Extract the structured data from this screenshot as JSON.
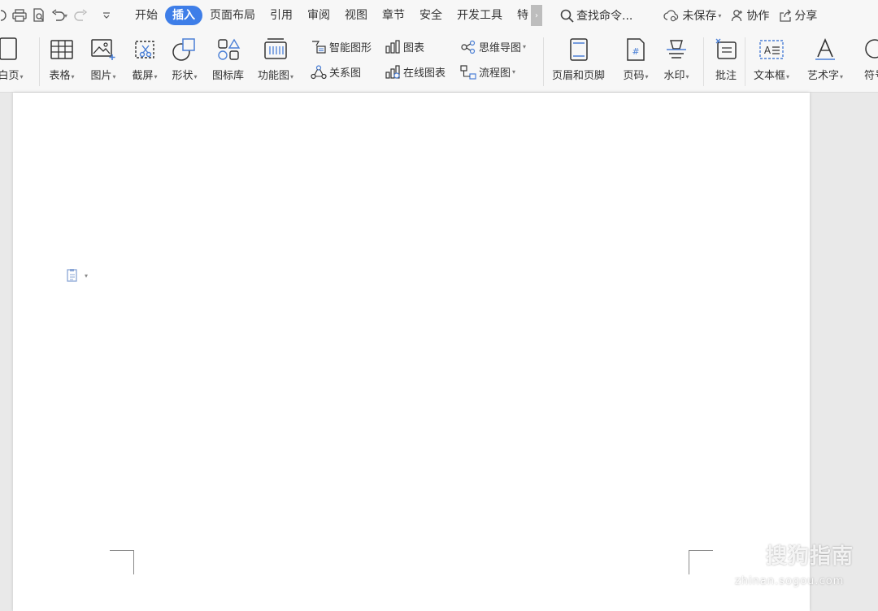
{
  "menu": {
    "tabs": [
      {
        "label": "开始"
      },
      {
        "label": "插入",
        "active": true
      },
      {
        "label": "页面布局"
      },
      {
        "label": "引用"
      },
      {
        "label": "审阅"
      },
      {
        "label": "视图"
      },
      {
        "label": "章节"
      },
      {
        "label": "安全"
      },
      {
        "label": "开发工具"
      },
      {
        "label": "特"
      }
    ],
    "more_glyph": "›",
    "search_label": "查找命令...",
    "unsaved_label": "未保存",
    "collab_label": "协作",
    "share_label": "分享"
  },
  "ribbon": {
    "blank_page": "白页",
    "table": "表格",
    "picture": "图片",
    "screenshot": "截屏",
    "shape": "形状",
    "icon_library": "图标库",
    "function_chart": "功能图",
    "smart_art": "智能图形",
    "chart": "图表",
    "mind_map": "思维导图",
    "relation_chart": "关系图",
    "online_chart": "在线图表",
    "flowchart": "流程图",
    "header_footer": "页眉和页脚",
    "page_number": "页码",
    "watermark": "水印",
    "comment": "批注",
    "text_box": "文本框",
    "word_art": "艺术字",
    "symbol": "符号"
  },
  "watermark": {
    "brand": "搜狗指南",
    "domain": "zhinan.sogou.com"
  },
  "colors": {
    "accent": "#3e7ee8",
    "icon_blue": "#4a7fd6",
    "toolbar_bg": "#f7f7f7"
  }
}
